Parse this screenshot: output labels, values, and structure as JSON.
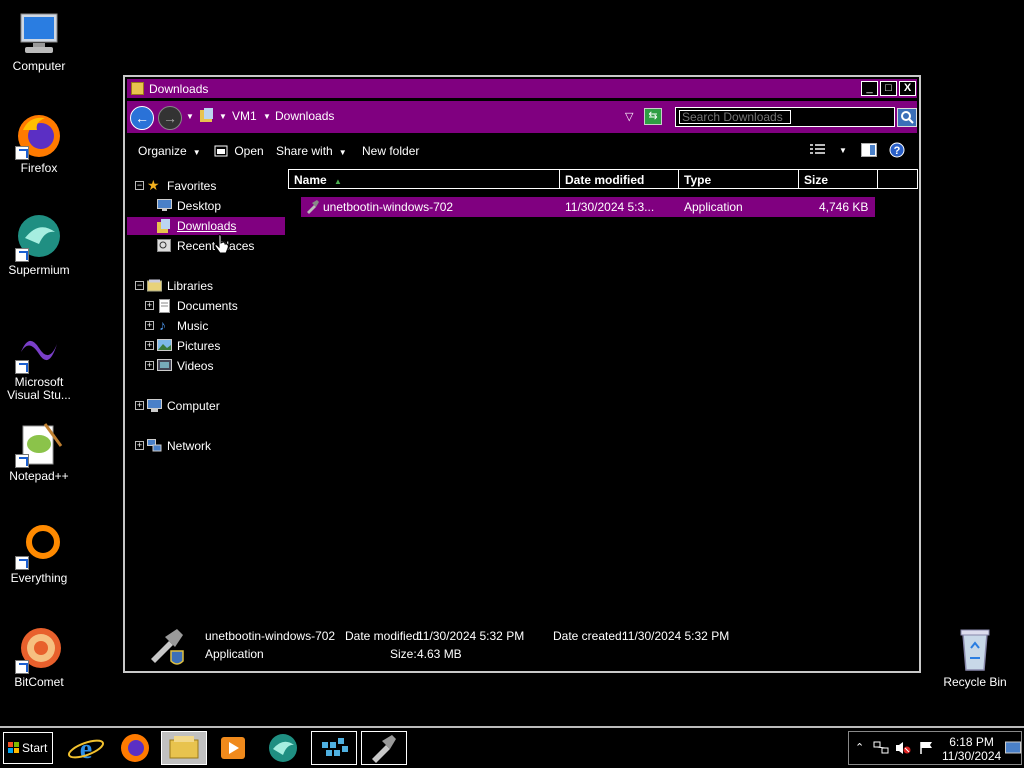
{
  "desktop": {
    "icons": [
      {
        "label": "Computer",
        "icon": "computer-icon"
      },
      {
        "label": "Firefox",
        "icon": "firefox-icon"
      },
      {
        "label": "Supermium",
        "icon": "supermium-icon"
      },
      {
        "label": "Microsoft Visual Stu...",
        "icon": "visual-studio-icon"
      },
      {
        "label": "Notepad++",
        "icon": "notepadpp-icon"
      },
      {
        "label": "Everything",
        "icon": "everything-icon"
      },
      {
        "label": "BitComet",
        "icon": "bitcomet-icon"
      },
      {
        "label": "Recycle Bin",
        "icon": "recycle-bin-icon"
      }
    ]
  },
  "window": {
    "title": "Downloads",
    "controls": {
      "minimize": "_",
      "maximize": "□",
      "close": "X"
    },
    "breadcrumb": [
      "VM1",
      "Downloads"
    ],
    "search": {
      "placeholder": "Search Downloads",
      "value": ""
    },
    "toolbar": {
      "organize": "Organize",
      "open": "Open",
      "share_with": "Share with",
      "new_folder": "New folder"
    },
    "nav": {
      "favorites": "Favorites",
      "desktop": "Desktop",
      "downloads": "Downloads",
      "recent_places": "Recent Places",
      "libraries": "Libraries",
      "documents": "Documents",
      "music": "Music",
      "pictures": "Pictures",
      "videos": "Videos",
      "computer": "Computer",
      "network": "Network"
    },
    "columns": {
      "name": "Name",
      "date_modified": "Date modified",
      "type": "Type",
      "size": "Size"
    },
    "files": [
      {
        "name": "unetbootin-windows-702",
        "date_modified": "11/30/2024 5:3...",
        "type": "Application",
        "size": "4,746 KB"
      }
    ],
    "details": {
      "name": "unetbootin-windows-702",
      "type": "Application",
      "date_modified_label": "Date modified:",
      "date_modified": "11/30/2024 5:32 PM",
      "date_created_label": "Date created:",
      "date_created": "11/30/2024 5:32 PM",
      "size_label": "Size:",
      "size": "4.63 MB"
    }
  },
  "taskbar": {
    "start_label": "Start",
    "time": "6:18 PM",
    "date": "11/30/2024"
  },
  "colors": {
    "accent": "#800080",
    "background": "#000000"
  }
}
